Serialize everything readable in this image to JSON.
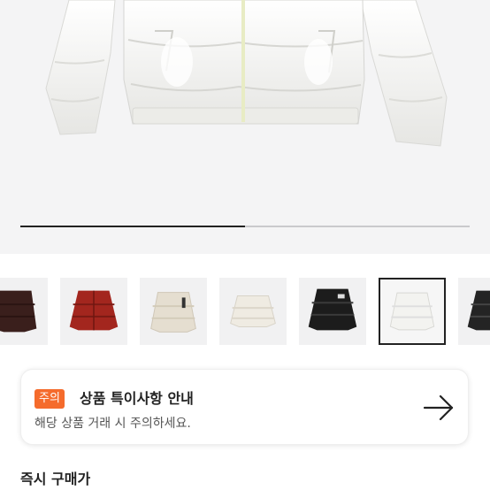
{
  "product_gallery": {
    "progress_fraction": 0.5,
    "thumbnails": [
      {
        "label": "brown-jacket-thumbnail"
      },
      {
        "label": "red-jacket-thumbnail"
      },
      {
        "label": "cream-jacket-thumbnail"
      },
      {
        "label": "ivory-jacket-thumbnail"
      },
      {
        "label": "black-jacket-thumbnail"
      },
      {
        "label": "white-jacket-thumbnail",
        "selected": true
      },
      {
        "label": "black-jacket-2-thumbnail"
      }
    ]
  },
  "notice": {
    "badge": "주의",
    "title": "상품 특이사항 안내",
    "description": "해당 상품 거래 시 주의하세요.",
    "icon": "arrow-right-icon"
  },
  "section": {
    "title": "즉시 구매가"
  },
  "colors": {
    "badge": "#f56b2c",
    "accent": "#222222"
  }
}
